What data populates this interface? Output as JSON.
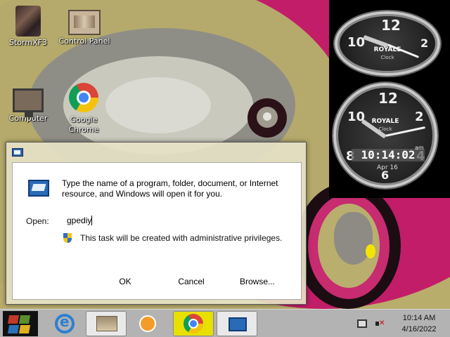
{
  "desktop": {
    "icons": [
      {
        "label": "StormXF3"
      },
      {
        "label": "Control Panel"
      },
      {
        "label": "Computer"
      },
      {
        "label": "Google Chrome"
      }
    ]
  },
  "clocks": {
    "brand": "ROYALE",
    "subbrand": "Clock",
    "numerals": [
      "12",
      "10",
      "2",
      "8",
      "6",
      "4"
    ],
    "digital_time": "10:14:02",
    "ampm": "am",
    "date": "Apr 16"
  },
  "run_dialog": {
    "description": "Type the name of a program, folder, document, or Internet resource, and Windows will open it for you.",
    "open_label": "Open:",
    "open_value": "gpediy",
    "admin_note": "This task will be created with administrative privileges.",
    "ok_label": "OK",
    "cancel_label": "Cancel",
    "browse_label": "Browse..."
  },
  "taskbar": {
    "time": "10:14 AM",
    "date": "4/16/2022"
  },
  "colors": {
    "wallpaper_pink": "#c21d68",
    "wallpaper_olive": "#b5aa6b",
    "chrome_taskbar_highlight": "#e8e000"
  }
}
